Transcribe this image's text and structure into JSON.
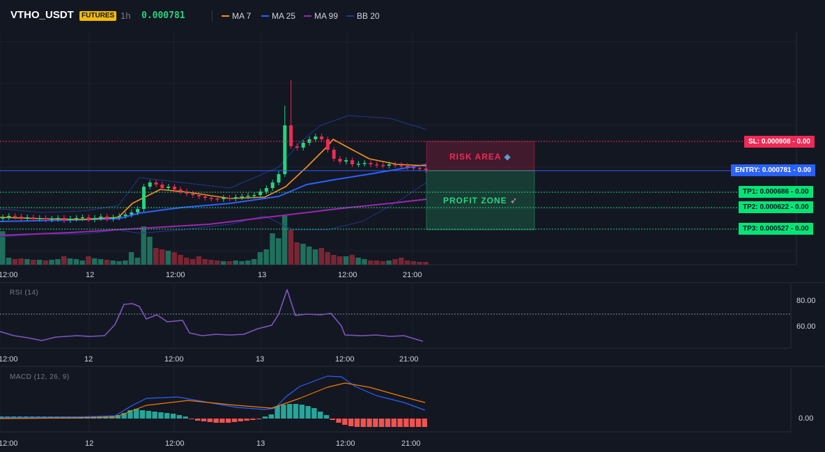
{
  "header": {
    "symbol": "VTHO_USDT",
    "market_badge": "FUTURES",
    "timeframe": "1h",
    "price": "0.000781"
  },
  "legend": [
    {
      "label": "MA 7",
      "color": "#f7931a"
    },
    {
      "label": "MA 25",
      "color": "#2962ff"
    },
    {
      "label": "MA 99",
      "color": "#9c27b0"
    },
    {
      "label": "BB 20",
      "color": "#1e3a8a"
    }
  ],
  "colors": {
    "background": "#131722",
    "up": "#26d47f",
    "down": "#ef2a55",
    "rsi": "#7e57c2",
    "macd": "#2962ff",
    "signal": "#f57c00",
    "hist_pos": "#26a69a",
    "hist_neg": "#ef5350"
  },
  "zones": {
    "risk": {
      "label": "RISK AREA",
      "icon": "shield-icon"
    },
    "profit": {
      "label": "PROFIT ZONE",
      "icon": "rocket-icon"
    }
  },
  "levels": {
    "sl": {
      "label": "SL: 0.000908 - 0.00"
    },
    "entry": {
      "label": "ENTRY: 0.000781 - 0.00"
    },
    "tp1": {
      "label": "TP1: 0.000686 - 0.00"
    },
    "tp2": {
      "label": "TP2: 0.000622 - 0.00"
    },
    "tp3": {
      "label": "TP3: 0.000527 - 0.00"
    }
  },
  "time_axis": [
    "12:00",
    "12",
    "12:00",
    "13",
    "12:00",
    "21:00"
  ],
  "rsi_pane": {
    "title": "RSI (14)",
    "axis": [
      "80.00",
      "60.00"
    ]
  },
  "macd_pane": {
    "title": "MACD (12, 26, 9)",
    "axis": [
      "0.00"
    ]
  }
}
